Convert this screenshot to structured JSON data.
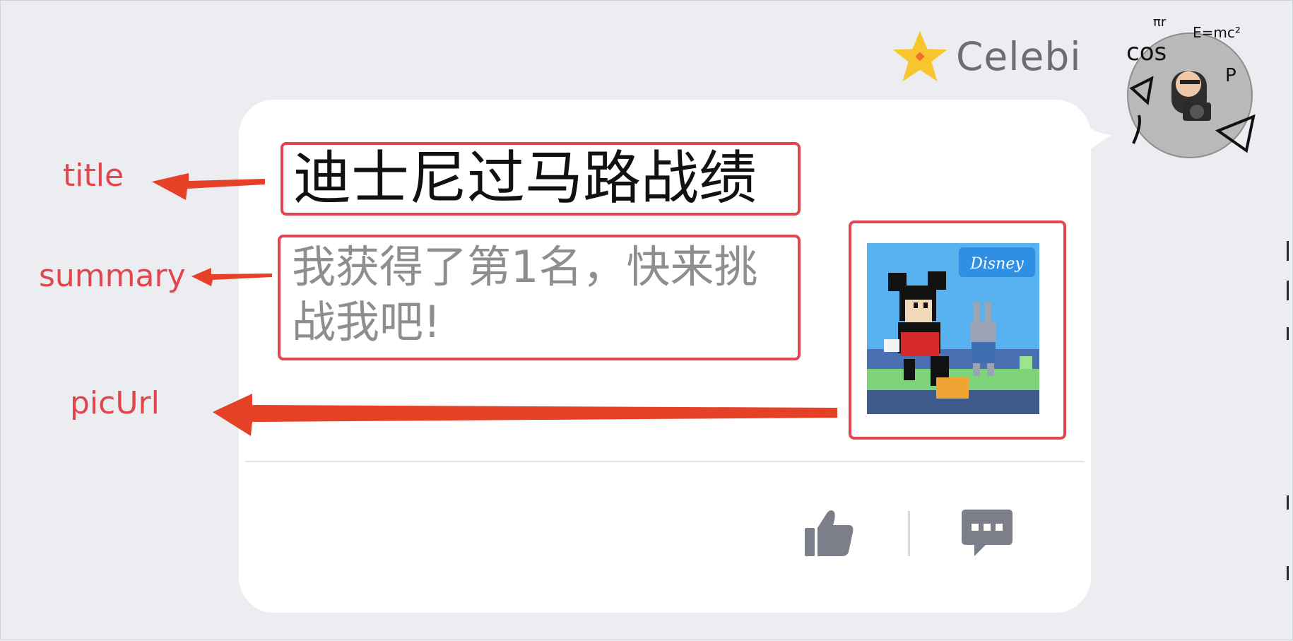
{
  "user": {
    "name": "Celebi"
  },
  "card": {
    "title": "迪士尼过马路战绩",
    "summary": "我获得了第1名，快来挑战我吧!"
  },
  "annotations": {
    "title": "title",
    "summary": "summary",
    "picUrl": "picUrl"
  },
  "icons": {
    "badge": "star-icon",
    "avatar": "avatar-photo",
    "thumbnail": "disney-crossy-road-thumbnail",
    "like": "thumbs-up-icon",
    "comment": "comment-bubble-icon"
  },
  "colors": {
    "annotation": "#e2454d",
    "action_icon": "#7c7f8a",
    "star": "#f7c62f",
    "disney_blue": "#2f8fe3"
  }
}
